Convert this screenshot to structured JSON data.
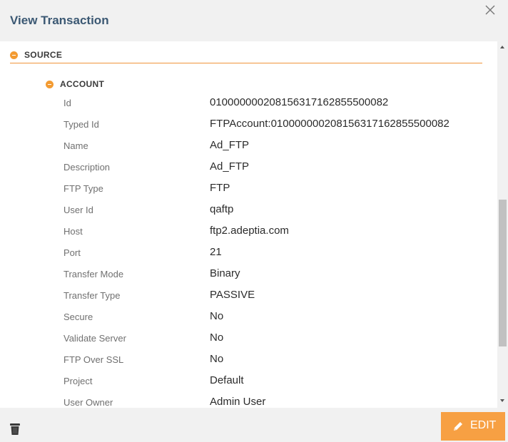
{
  "header": {
    "title": "View Transaction"
  },
  "source": {
    "label": "SOURCE"
  },
  "account": {
    "label": "ACCOUNT",
    "fields": [
      {
        "label": "Id",
        "value": "010000000208156317162855500082"
      },
      {
        "label": "Typed Id",
        "value": "FTPAccount:010000000208156317162855500082"
      },
      {
        "label": "Name",
        "value": "Ad_FTP"
      },
      {
        "label": "Description",
        "value": "Ad_FTP"
      },
      {
        "label": "FTP Type",
        "value": "FTP"
      },
      {
        "label": "User Id",
        "value": "qaftp"
      },
      {
        "label": "Host",
        "value": "ftp2.adeptia.com"
      },
      {
        "label": "Port",
        "value": "21"
      },
      {
        "label": "Transfer Mode",
        "value": "Binary"
      },
      {
        "label": "Transfer Type",
        "value": "PASSIVE"
      },
      {
        "label": "Secure",
        "value": "No"
      },
      {
        "label": "Validate Server",
        "value": "No"
      },
      {
        "label": "FTP Over SSL",
        "value": "No"
      },
      {
        "label": "Project",
        "value": "Default"
      },
      {
        "label": "User Owner",
        "value": "Admin User"
      }
    ]
  },
  "footer": {
    "edit_label": "EDIT"
  },
  "icons": {
    "close": "close-icon",
    "trash": "trash-icon",
    "edit": "pencil-icon",
    "collapse": "minus-circle-icon"
  },
  "colors": {
    "accent": "#f7a043",
    "title": "#3b5873",
    "divider": "#f0953b"
  }
}
